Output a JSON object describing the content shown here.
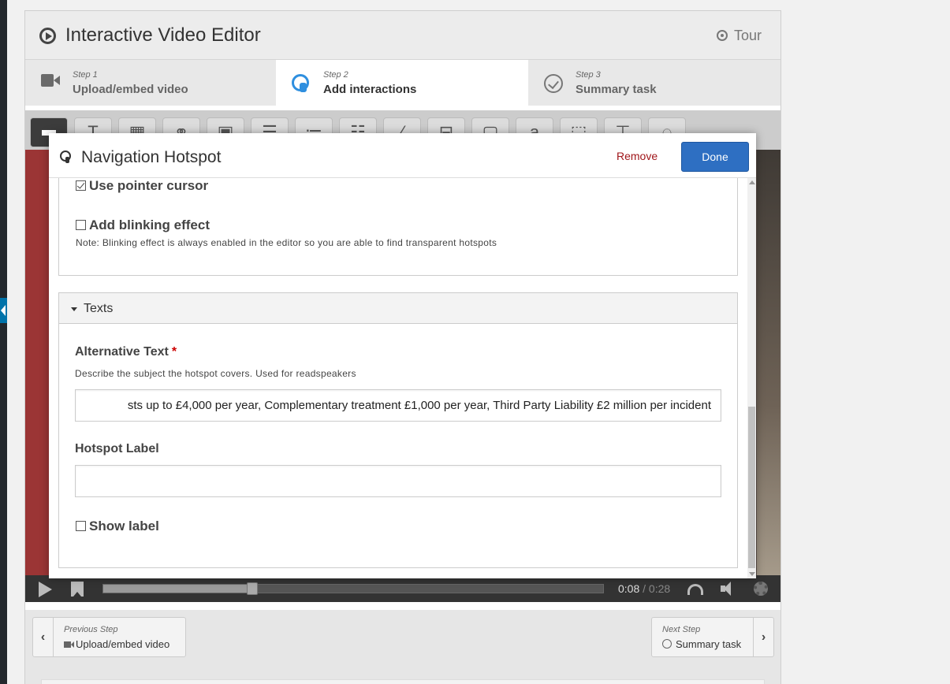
{
  "app": {
    "title": "Interactive Video Editor",
    "tour_label": "Tour"
  },
  "steps": [
    {
      "number": "Step 1",
      "label": "Upload/embed video",
      "icon": "video-camera-icon"
    },
    {
      "number": "Step 2",
      "label": "Add interactions",
      "icon": "pointer-icon",
      "active": true
    },
    {
      "number": "Step 3",
      "label": "Summary task",
      "icon": "check-circle-icon"
    }
  ],
  "toolbar": {
    "tools": [
      "label",
      "text",
      "table",
      "link",
      "image",
      "statements",
      "single-choice",
      "multiple-choice",
      "fill-blanks",
      "drag-text",
      "mark-words",
      "drag-drop",
      "crossroads",
      "navigation-hotspot",
      "hotspot"
    ]
  },
  "player": {
    "current_time": "0:08",
    "separator": "/",
    "total_time": "0:28",
    "progress": 0.298
  },
  "dialog": {
    "title": "Navigation Hotspot",
    "remove_label": "Remove",
    "done_label": "Done",
    "pointer_cursor": {
      "label": "Use pointer cursor",
      "checked": true
    },
    "blinking": {
      "label": "Add blinking effect",
      "checked": false
    },
    "blinking_note": "Note: Blinking effect is always enabled in the editor so you are able to find transparent hotspots",
    "texts_group": {
      "title": "Texts",
      "alt_text": {
        "label": "Alternative Text",
        "required_mark": "*",
        "description": "Describe the subject the hotspot covers. Used for readspeakers",
        "value": "sts up to £4,000  per year, Complementary treatment £1,000  per year, Third Party Liability £2 million per incident"
      },
      "hotspot_label": {
        "label": "Hotspot Label",
        "value": ""
      },
      "show_label": {
        "label": "Show label",
        "checked": false
      }
    }
  },
  "nav": {
    "previous": {
      "small": "Previous Step",
      "label": "Upload/embed video"
    },
    "next": {
      "small": "Next Step",
      "label": "Summary task"
    }
  },
  "colors": {
    "done_button": "#2e6fc2",
    "remove_link": "#a0161a",
    "active_step_icon": "#2f8fdf",
    "required": "#cc0000"
  }
}
